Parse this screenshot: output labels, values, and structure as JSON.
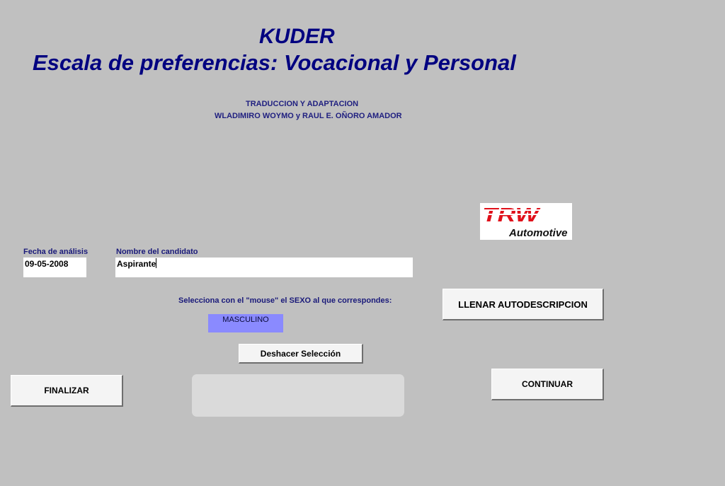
{
  "header": {
    "title": "KUDER",
    "subtitle": "Escala de preferencias: Vocacional y Personal",
    "credit_line1": "TRADUCCION Y ADAPTACION",
    "credit_line2": "WLADIMIRO WOYMO y RAUL E. OÑORO AMADOR"
  },
  "logo": {
    "brand": "TRW",
    "tagline": "Automotive",
    "brand_color": "#e0101a"
  },
  "form": {
    "date_label": "Fecha de análisis",
    "date_value": "09-05-2008",
    "name_label": "Nombre del candidato",
    "name_value": "Aspirante",
    "sex_instruction": "Selecciona con el \"mouse\" el SEXO al que correspondes:",
    "sex_selected": "MASCULINO",
    "sex_selected_color": "#8a8aff"
  },
  "buttons": {
    "llenar": "LLENAR AUTODESCRIPCION",
    "deshacer": "Deshacer Selección",
    "finalizar": "FINALIZAR",
    "continuar": "CONTINUAR"
  },
  "colors": {
    "background": "#c0c0c0",
    "title": "#000080"
  }
}
